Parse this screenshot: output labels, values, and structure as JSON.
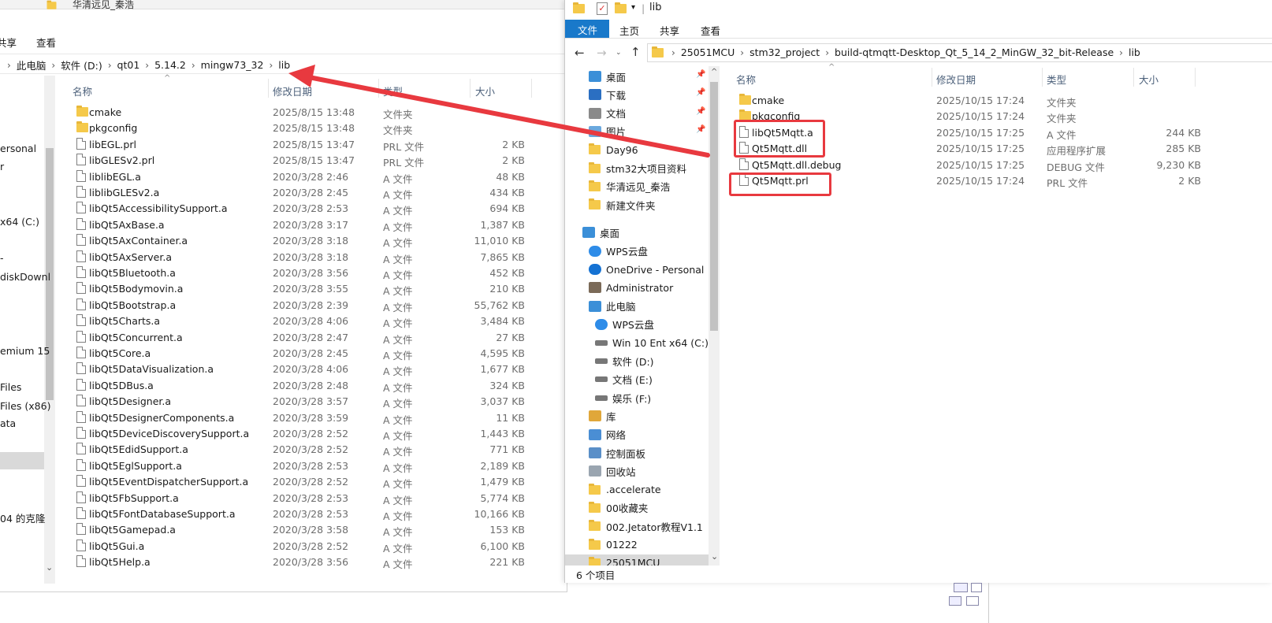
{
  "left": {
    "top_title": "华清远见_秦浩",
    "ribbon": [
      "共享",
      "查看"
    ],
    "breadcrumb": [
      "此电脑",
      "软件 (D:)",
      "qt01",
      "5.14.2",
      "mingw73_32",
      "lib"
    ],
    "columns": [
      "名称",
      "修改日期",
      "类型",
      "大小"
    ],
    "nav_partial": [
      "ersonal",
      "r",
      "x64 (C:)",
      "-",
      "diskDownl",
      "emium 15",
      "Files",
      "Files (x86)",
      "ata",
      "04 的克隆"
    ],
    "files": [
      {
        "name": "cmake",
        "date": "2025/8/15 13:48",
        "type": "文件夹",
        "size": "",
        "folder": true
      },
      {
        "name": "pkgconfig",
        "date": "2025/8/15 13:48",
        "type": "文件夹",
        "size": "",
        "folder": true
      },
      {
        "name": "libEGL.prl",
        "date": "2025/8/15 13:47",
        "type": "PRL 文件",
        "size": "2 KB"
      },
      {
        "name": "libGLESv2.prl",
        "date": "2025/8/15 13:47",
        "type": "PRL 文件",
        "size": "2 KB"
      },
      {
        "name": "liblibEGL.a",
        "date": "2020/3/28 2:46",
        "type": "A 文件",
        "size": "48 KB"
      },
      {
        "name": "liblibGLESv2.a",
        "date": "2020/3/28 2:45",
        "type": "A 文件",
        "size": "434 KB"
      },
      {
        "name": "libQt5AccessibilitySupport.a",
        "date": "2020/3/28 2:53",
        "type": "A 文件",
        "size": "694 KB"
      },
      {
        "name": "libQt5AxBase.a",
        "date": "2020/3/28 3:17",
        "type": "A 文件",
        "size": "1,387 KB"
      },
      {
        "name": "libQt5AxContainer.a",
        "date": "2020/3/28 3:18",
        "type": "A 文件",
        "size": "11,010 KB"
      },
      {
        "name": "libQt5AxServer.a",
        "date": "2020/3/28 3:18",
        "type": "A 文件",
        "size": "7,865 KB"
      },
      {
        "name": "libQt5Bluetooth.a",
        "date": "2020/3/28 3:56",
        "type": "A 文件",
        "size": "452 KB"
      },
      {
        "name": "libQt5Bodymovin.a",
        "date": "2020/3/28 3:55",
        "type": "A 文件",
        "size": "210 KB"
      },
      {
        "name": "libQt5Bootstrap.a",
        "date": "2020/3/28 2:39",
        "type": "A 文件",
        "size": "55,762 KB"
      },
      {
        "name": "libQt5Charts.a",
        "date": "2020/3/28 4:06",
        "type": "A 文件",
        "size": "3,484 KB"
      },
      {
        "name": "libQt5Concurrent.a",
        "date": "2020/3/28 2:47",
        "type": "A 文件",
        "size": "27 KB"
      },
      {
        "name": "libQt5Core.a",
        "date": "2020/3/28 2:45",
        "type": "A 文件",
        "size": "4,595 KB"
      },
      {
        "name": "libQt5DataVisualization.a",
        "date": "2020/3/28 4:06",
        "type": "A 文件",
        "size": "1,677 KB"
      },
      {
        "name": "libQt5DBus.a",
        "date": "2020/3/28 2:48",
        "type": "A 文件",
        "size": "324 KB"
      },
      {
        "name": "libQt5Designer.a",
        "date": "2020/3/28 3:57",
        "type": "A 文件",
        "size": "3,037 KB"
      },
      {
        "name": "libQt5DesignerComponents.a",
        "date": "2020/3/28 3:59",
        "type": "A 文件",
        "size": "11 KB"
      },
      {
        "name": "libQt5DeviceDiscoverySupport.a",
        "date": "2020/3/28 2:52",
        "type": "A 文件",
        "size": "1,443 KB"
      },
      {
        "name": "libQt5EdidSupport.a",
        "date": "2020/3/28 2:52",
        "type": "A 文件",
        "size": "771 KB"
      },
      {
        "name": "libQt5EglSupport.a",
        "date": "2020/3/28 2:53",
        "type": "A 文件",
        "size": "2,189 KB"
      },
      {
        "name": "libQt5EventDispatcherSupport.a",
        "date": "2020/3/28 2:52",
        "type": "A 文件",
        "size": "1,479 KB"
      },
      {
        "name": "libQt5FbSupport.a",
        "date": "2020/3/28 2:53",
        "type": "A 文件",
        "size": "5,774 KB"
      },
      {
        "name": "libQt5FontDatabaseSupport.a",
        "date": "2020/3/28 2:53",
        "type": "A 文件",
        "size": "10,166 KB"
      },
      {
        "name": "libQt5Gamepad.a",
        "date": "2020/3/28 3:58",
        "type": "A 文件",
        "size": "153 KB"
      },
      {
        "name": "libQt5Gui.a",
        "date": "2020/3/28 2:52",
        "type": "A 文件",
        "size": "6,100 KB"
      },
      {
        "name": "libQt5Help.a",
        "date": "2020/3/28 3:56",
        "type": "A 文件",
        "size": "221 KB"
      }
    ]
  },
  "right": {
    "title": "lib",
    "ribbon": [
      "文件",
      "主页",
      "共享",
      "查看"
    ],
    "breadcrumb": [
      "25051MCU",
      "stm32_project",
      "build-qtmqtt-Desktop_Qt_5_14_2_MinGW_32_bit-Release",
      "lib"
    ],
    "columns": [
      "名称",
      "修改日期",
      "类型",
      "大小"
    ],
    "status": "6 个项目",
    "nav": [
      {
        "label": "桌面",
        "icon": "desktop-icon",
        "pin": true
      },
      {
        "label": "下载",
        "icon": "download-icon",
        "pin": true
      },
      {
        "label": "文档",
        "icon": "document-icon",
        "pin": true
      },
      {
        "label": "图片",
        "icon": "picture-icon",
        "pin": true
      },
      {
        "label": "Day96",
        "icon": "folder-icon"
      },
      {
        "label": "stm32大项目资料",
        "icon": "folder-icon"
      },
      {
        "label": "华清远见_秦浩",
        "icon": "folder-icon"
      },
      {
        "label": "新建文件夹",
        "icon": "folder-icon"
      },
      {
        "label": "桌面",
        "icon": "desktop-icon",
        "gap": true,
        "level": 0
      },
      {
        "label": "WPS云盘",
        "icon": "cloud-icon"
      },
      {
        "label": "OneDrive - Personal",
        "icon": "onedrive-icon"
      },
      {
        "label": "Administrator",
        "icon": "user-icon"
      },
      {
        "label": "此电脑",
        "icon": "computer-icon"
      },
      {
        "label": "WPS云盘",
        "icon": "cloud-icon",
        "level": 2
      },
      {
        "label": "Win 10 Ent x64 (C:)",
        "icon": "drive-icon",
        "level": 2
      },
      {
        "label": "软件 (D:)",
        "icon": "drive-icon",
        "level": 2
      },
      {
        "label": "文档 (E:)",
        "icon": "drive-icon",
        "level": 2
      },
      {
        "label": "娱乐 (F:)",
        "icon": "drive-icon",
        "level": 2
      },
      {
        "label": "库",
        "icon": "library-icon"
      },
      {
        "label": "网络",
        "icon": "network-icon"
      },
      {
        "label": "控制面板",
        "icon": "control-panel-icon"
      },
      {
        "label": "回收站",
        "icon": "recycle-bin-icon"
      },
      {
        "label": ".accelerate",
        "icon": "folder-icon"
      },
      {
        "label": "00收藏夹",
        "icon": "folder-icon"
      },
      {
        "label": "002.Jetator教程V1.1",
        "icon": "folder-icon"
      },
      {
        "label": "01222",
        "icon": "folder-icon"
      },
      {
        "label": "25051MCU",
        "icon": "folder-icon",
        "selected": true
      }
    ],
    "files": [
      {
        "name": "cmake",
        "date": "2025/10/15 17:24",
        "type": "文件夹",
        "size": "",
        "folder": true
      },
      {
        "name": "pkgconfig",
        "date": "2025/10/15 17:24",
        "type": "文件夹",
        "size": "",
        "folder": true
      },
      {
        "name": "libQt5Mqtt.a",
        "date": "2025/10/15 17:25",
        "type": "A 文件",
        "size": "244 KB"
      },
      {
        "name": "Qt5Mqtt.dll",
        "date": "2025/10/15 17:25",
        "type": "应用程序扩展",
        "size": "285 KB"
      },
      {
        "name": "Qt5Mqtt.dll.debug",
        "date": "2025/10/15 17:25",
        "type": "DEBUG 文件",
        "size": "9,230 KB"
      },
      {
        "name": "Qt5Mqtt.prl",
        "date": "2025/10/15 17:24",
        "type": "PRL 文件",
        "size": "2 KB"
      }
    ]
  },
  "colors": {
    "accent": "#1979ca",
    "annotation": "#e8393f",
    "folder": "#f5c94a"
  }
}
